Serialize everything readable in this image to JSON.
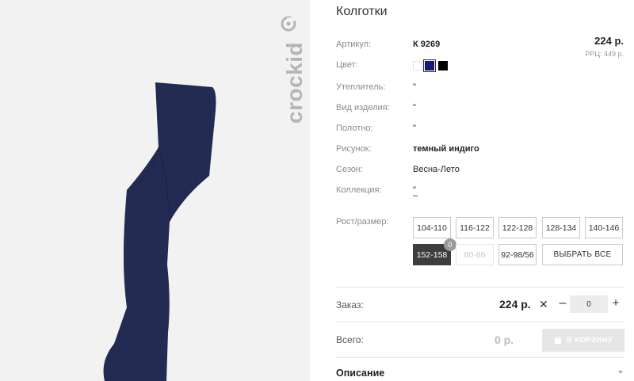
{
  "brand": {
    "name": "crockid"
  },
  "product": {
    "title": "Колготки",
    "price": "224 р.",
    "rrp": "РРЦ: 449 р.",
    "attributes": [
      {
        "label": "Артикул:",
        "value": "К 9269"
      },
      {
        "label": "Цвет:",
        "value": ""
      },
      {
        "label": "Утеплитель:",
        "value": "\""
      },
      {
        "label": "Вид изделия:",
        "value": "\""
      },
      {
        "label": "Полотно:",
        "value": "\""
      },
      {
        "label": "Рисунок:",
        "value": "темный индиго"
      },
      {
        "label": "Сезон:",
        "value": "Весна-Лето"
      },
      {
        "label": "Коллекция:",
        "value": "\""
      }
    ],
    "colors": [
      {
        "name": "white",
        "hex": "#ffffff"
      },
      {
        "name": "navy",
        "hex": "#151a72",
        "selected": true
      },
      {
        "name": "black",
        "hex": "#000000"
      }
    ],
    "product_color": "#232b52"
  },
  "sizes": {
    "label": "Рост/размер:",
    "options": [
      "104-110",
      "116-122",
      "122-128",
      "128-134",
      "140-146",
      "152-158",
      "80-86",
      "92-98/56"
    ],
    "selected": "152-158",
    "disabled": [
      "80-86"
    ],
    "badge": "0",
    "select_all_label": "ВЫБРАТЬ ВСЕ"
  },
  "order": {
    "label": "Заказ:",
    "price": "224 р.",
    "times": "✕",
    "minus": "–",
    "quantity": "0",
    "plus": "+"
  },
  "total": {
    "label": "Всего:",
    "value": "0 р.",
    "cart_label": "В КОРЗИНУ"
  },
  "description": {
    "label": "Описание"
  }
}
